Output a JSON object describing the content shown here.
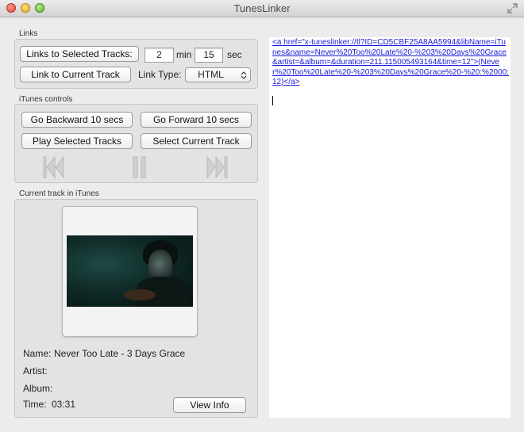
{
  "window": {
    "title": "TunesLinker"
  },
  "links": {
    "section_label": "Links",
    "selected_tracks_button": "Links to Selected Tracks:",
    "minutes_value": "2",
    "min_label": "min",
    "seconds_value": "15",
    "sec_label": "sec",
    "current_track_button": "Link to Current Track",
    "link_type_label": "Link Type:",
    "link_type_value": "HTML"
  },
  "controls": {
    "section_label": "iTunes controls",
    "backward_button": "Go Backward 10 secs",
    "forward_button": "Go Forward 10 secs",
    "play_selected_button": "Play Selected Tracks",
    "select_current_button": "Select Current Track",
    "transport_icons": [
      "previous-track-icon",
      "pause-icon",
      "next-track-icon"
    ]
  },
  "current_track": {
    "section_label": "Current track in iTunes",
    "name_label": "Name:",
    "name_value": "Never Too Late - 3 Days Grace",
    "artist_label": "Artist:",
    "artist_value": "",
    "album_label": "Album:",
    "album_value": "",
    "time_label": "Time:",
    "time_value": "03:31",
    "view_info_button": "View Info"
  },
  "output": {
    "text": "<a href=\"x-tuneslinker://tl?ID=CD5CBF25A8AA5994&libName=iTunes&name=Never%20Too%20Late%20-%203%20Days%20Grace&artist=&album=&duration=211.115005493164&time=12\">(Never%20Too%20Late%20-%203%20Days%20Grace%20-%20:%2000:12)</a>",
    "link_color": "#1a1ad8"
  }
}
